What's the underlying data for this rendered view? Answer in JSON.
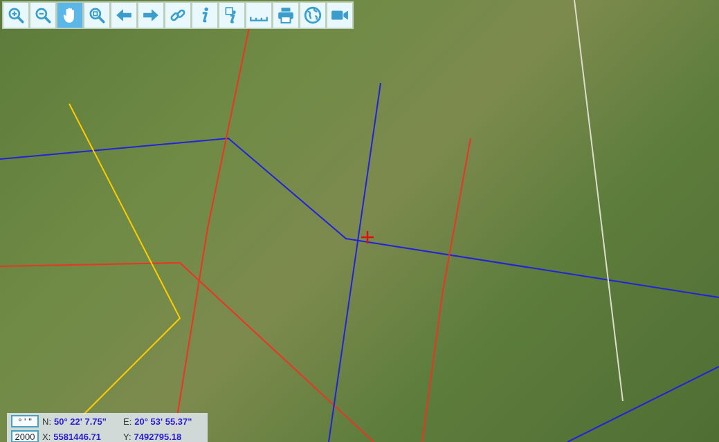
{
  "toolbar": [
    {
      "kind": "zoom-in",
      "selected": false
    },
    {
      "kind": "zoom-out",
      "selected": false
    },
    {
      "kind": "pan",
      "selected": true
    },
    {
      "kind": "zoom-box",
      "selected": false
    },
    {
      "kind": "back",
      "selected": false
    },
    {
      "kind": "forward",
      "selected": false
    },
    {
      "kind": "link",
      "selected": false
    },
    {
      "kind": "info",
      "selected": false
    },
    {
      "kind": "info-box",
      "selected": false
    },
    {
      "kind": "measure",
      "selected": false
    },
    {
      "kind": "print",
      "selected": false
    },
    {
      "kind": "globe",
      "selected": false
    },
    {
      "kind": "video",
      "selected": false
    }
  ],
  "coordinates": {
    "format_button": "° ' \"",
    "scale_button": "2000",
    "rows": [
      {
        "items": [
          {
            "label": "N:",
            "value": "50° 22' 7.75\""
          },
          {
            "label": "E:",
            "value": "20° 53' 55.37\""
          }
        ]
      },
      {
        "items": [
          {
            "label": "X:",
            "value": "5581446.71"
          },
          {
            "label": "Y:",
            "value": "7492795.18"
          }
        ]
      }
    ]
  }
}
